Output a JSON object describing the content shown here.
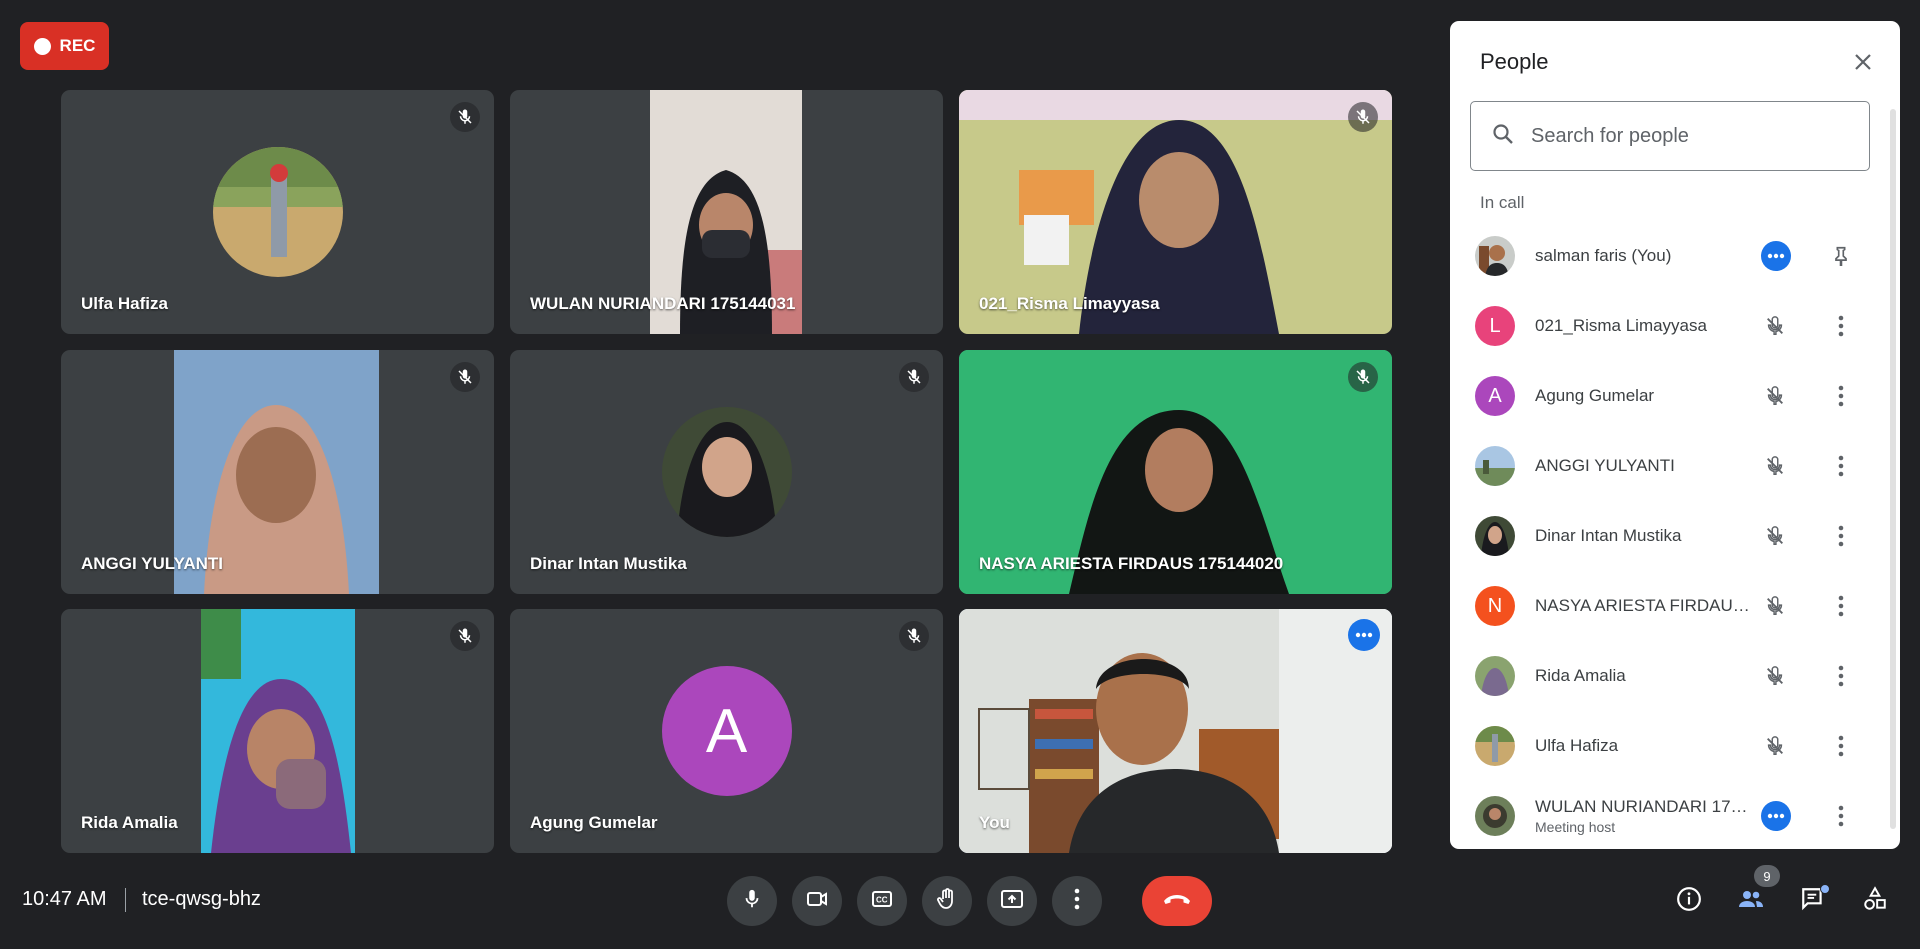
{
  "recording": {
    "label": "REC"
  },
  "tiles": [
    {
      "name": "Ulfa Hafiza"
    },
    {
      "name": "WULAN NURIANDARI 175144031"
    },
    {
      "name": "021_Risma Limayyasa"
    },
    {
      "name": "ANGGI YULYANTI"
    },
    {
      "name": "Dinar Intan Mustika"
    },
    {
      "name": "NASYA ARIESTA FIRDAUS 175144020"
    },
    {
      "name": "Rida Amalia"
    },
    {
      "name": "Agung Gumelar",
      "avatar_letter": "A"
    },
    {
      "name": "You"
    }
  ],
  "panel": {
    "title": "People",
    "search_placeholder": "Search for people",
    "section_label": "In call",
    "participants": [
      {
        "name": "salman faris (You)",
        "avatar": "photo",
        "action": "pin-icon"
      },
      {
        "name": "021_Risma Limayyasa",
        "avatar_letter": "L",
        "avatar_color": "#e8437b",
        "action": "more-vert-icon"
      },
      {
        "name": "Agung Gumelar",
        "avatar_letter": "A",
        "avatar_color": "#ab47bc",
        "action": "more-vert-icon"
      },
      {
        "name": "ANGGI YULYANTI",
        "avatar": "photo",
        "action": "more-vert-icon"
      },
      {
        "name": "Dinar Intan Mustika",
        "avatar": "photo",
        "action": "more-vert-icon"
      },
      {
        "name": "NASYA ARIESTA FIRDAUS ...",
        "avatar_letter": "N",
        "avatar_color": "#f4511e",
        "action": "more-vert-icon"
      },
      {
        "name": "Rida Amalia",
        "avatar": "photo",
        "action": "more-vert-icon"
      },
      {
        "name": "Ulfa Hafiza",
        "avatar": "photo",
        "action": "more-vert-icon"
      },
      {
        "name": "WULAN NURIANDARI 1751...",
        "subtitle": "Meeting host",
        "avatar": "photo",
        "action": "more-vert-icon"
      }
    ]
  },
  "bottom": {
    "time": "10:47 AM",
    "meeting_code": "tce-qwsg-bhz",
    "people_count": "9"
  },
  "colors": {
    "background": "#202124",
    "tile": "#3c4043",
    "accent": "#1a73e8",
    "end_call": "#ea4335",
    "rec": "#d93025"
  }
}
